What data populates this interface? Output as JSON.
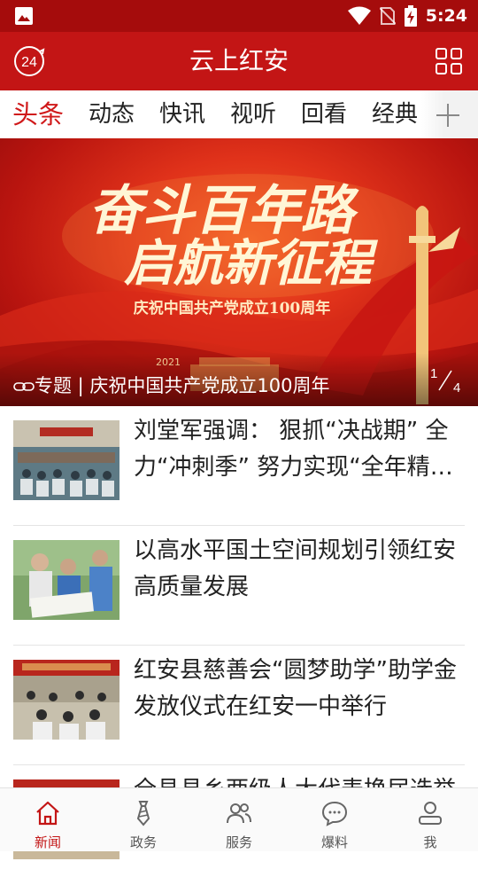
{
  "status_bar": {
    "time": "5:24"
  },
  "header": {
    "title": "云上红安"
  },
  "tabs": [
    {
      "label": "头条",
      "active": true
    },
    {
      "label": "动态"
    },
    {
      "label": "快讯"
    },
    {
      "label": "视听"
    },
    {
      "label": "回看"
    },
    {
      "label": "经典"
    }
  ],
  "banner": {
    "headline_line1": "奋斗百年路",
    "headline_line2": "启航新征程",
    "subtitle": "庆祝中国共产党成立100周年",
    "year": "2021",
    "caption": "专题 | 庆祝中国共产党成立100周年",
    "pager_current": "1",
    "pager_total": "4"
  },
  "news": [
    {
      "headline": "刘堂军强调： 狠抓“决战期” 全力“冲刺季” 努力实现“全年精彩”"
    },
    {
      "headline": "以高水平国土空间规划引领红安高质量发展"
    },
    {
      "headline": "红安县慈善会“圆梦助学”助学金发放仪式在红安一中举行"
    },
    {
      "headline": "全县县乡两级人大代表换届选举"
    }
  ],
  "bottom_nav": [
    {
      "label": "新闻",
      "icon": "home-icon",
      "active": true
    },
    {
      "label": "政务",
      "icon": "tie-icon"
    },
    {
      "label": "服务",
      "icon": "people-icon"
    },
    {
      "label": "爆料",
      "icon": "chat-bubble-icon"
    },
    {
      "label": "我",
      "icon": "user-icon"
    }
  ],
  "colors": {
    "brand_red": "#c31515",
    "status_bar": "#a50c0c",
    "active_tab": "#d0191a"
  }
}
